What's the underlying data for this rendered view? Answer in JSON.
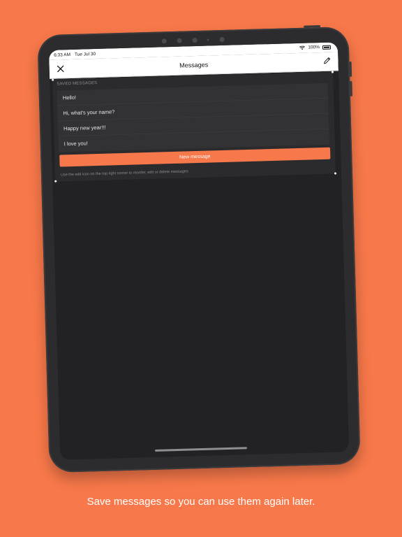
{
  "status_bar": {
    "time": "6:33 AM",
    "date": "Tue Jul 30",
    "battery": "100%"
  },
  "nav": {
    "title": "Messages",
    "close_icon": "close-icon",
    "edit_icon": "pencil-icon"
  },
  "section": {
    "header": "SAVED MESSAGES"
  },
  "messages": [
    "Hello!",
    "Hi, what's your name?",
    "Happy new year!!!",
    "I love you!"
  ],
  "new_message_button": "New message",
  "hint": "Use the edit icon on the top right corner to reorder, edit or delete messages",
  "caption": "Save messages so you can use them again later.",
  "colors": {
    "background": "#F7784A",
    "accent": "#F7784A",
    "screen": "#222224",
    "device": "#2c2c2e"
  }
}
